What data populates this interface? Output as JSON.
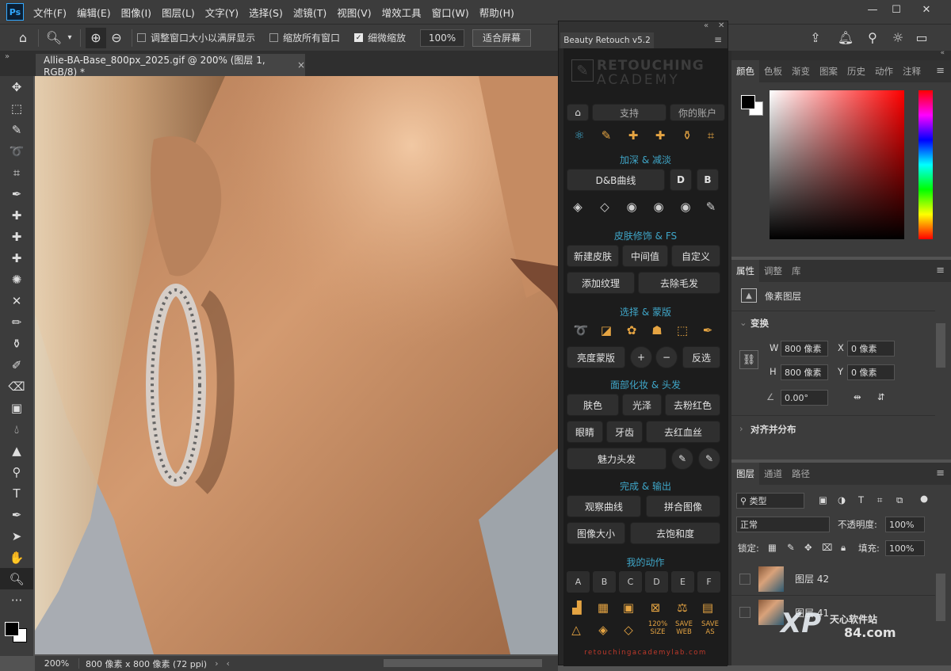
{
  "menubar": {
    "logo": "Ps",
    "items": [
      "文件(F)",
      "编辑(E)",
      "图像(I)",
      "图层(L)",
      "文字(Y)",
      "选择(S)",
      "滤镜(T)",
      "视图(V)",
      "增效工具",
      "窗口(W)",
      "帮助(H)"
    ]
  },
  "options": {
    "fit_window": "调整窗口大小以满屏显示",
    "zoom_all": "缩放所有窗口",
    "scrubby": "细微缩放",
    "zoom_value": "100%",
    "fit_screen": "适合屏幕"
  },
  "document": {
    "tab_title": "Allie-BA-Base_800px_2025.gif @ 200% (图层 1, RGB/8) *",
    "close": "×"
  },
  "status": {
    "zoom": "200%",
    "info": "800 像素 x 800 像素 (72 ppi)"
  },
  "plugin": {
    "tab": "Beauty Retouch v5.2",
    "logo_line1": "RETOUCHING",
    "logo_line2": "ACADEMY",
    "support": "支持",
    "account": "你的账户",
    "sec_db": "加深 & 减淡",
    "db_curve": "D&B曲线",
    "d_btn": "D",
    "b_btn": "B",
    "sec_skin": "皮肤修饰 & FS",
    "new_skin": "新建皮肤",
    "median": "中间值",
    "custom": "自定义",
    "add_texture": "添加纹理",
    "remove_hair": "去除毛发",
    "sec_select": "选择 & 蒙版",
    "lum_mask": "亮度蒙版",
    "plus": "+",
    "minus": "−",
    "invert": "反选",
    "sec_makeup": "面部化妆 & 头发",
    "skin_tone": "肤色",
    "gloss": "光泽",
    "remove_red": "去粉红色",
    "eyes": "眼睛",
    "teeth": "牙齿",
    "remove_veins": "去红血丝",
    "hair": "魅力头发",
    "sec_finish": "完成 & 输出",
    "view_curve": "观察曲线",
    "flatten": "拼合图像",
    "image_size": "图像大小",
    "desat": "去饱和度",
    "sec_actions": "我的动作",
    "actions": [
      "A",
      "B",
      "C",
      "D",
      "E",
      "F"
    ],
    "size_label": "120%\nSIZE",
    "web_label": "SAVE\nWEB",
    "as_label": "SAVE\nAS",
    "url": "retouchingacademylab.com"
  },
  "color_panel": {
    "tabs": [
      "颜色",
      "色板",
      "渐变",
      "图案",
      "历史",
      "动作",
      "注释"
    ]
  },
  "props_panel": {
    "tabs": [
      "属性",
      "调整",
      "库"
    ],
    "type": "像素图层",
    "transform": "变换",
    "w_label": "W",
    "w": "800 像素",
    "h_label": "H",
    "h": "800 像素",
    "x_label": "X",
    "x": "0 像素",
    "y_label": "Y",
    "y": "0 像素",
    "angle": "0.00°",
    "align": "对齐并分布"
  },
  "layers_panel": {
    "tabs": [
      "图层",
      "通道",
      "路径"
    ],
    "filter": "类型",
    "blend": "正常",
    "opacity_label": "不透明度:",
    "opacity": "100%",
    "lock_label": "锁定:",
    "fill_label": "填充:",
    "fill": "100%",
    "layers": [
      "图层 42",
      "图层 41"
    ]
  },
  "watermark": {
    "xp": "XP",
    "line1": "天心软件站",
    "line2": "84.com"
  }
}
